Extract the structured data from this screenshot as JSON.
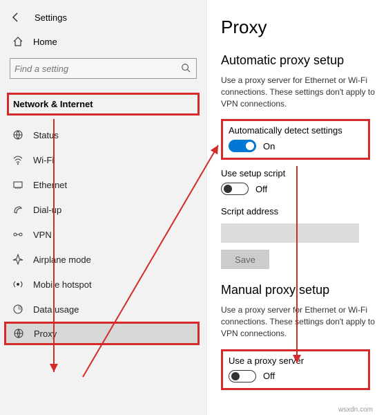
{
  "header": {
    "title": "Settings",
    "home_label": "Home",
    "search_placeholder": "Find a setting"
  },
  "category": "Network & Internet",
  "nav": {
    "items": [
      {
        "label": "Status"
      },
      {
        "label": "Wi-Fi"
      },
      {
        "label": "Ethernet"
      },
      {
        "label": "Dial-up"
      },
      {
        "label": "VPN"
      },
      {
        "label": "Airplane mode"
      },
      {
        "label": "Mobile hotspot"
      },
      {
        "label": "Data usage"
      },
      {
        "label": "Proxy"
      }
    ]
  },
  "main": {
    "title": "Proxy",
    "section1": {
      "title": "Automatic proxy setup",
      "desc": "Use a proxy server for Ethernet or Wi-Fi connections. These settings don't apply to VPN connections.",
      "auto_detect_label": "Automatically detect settings",
      "auto_detect_state": "On",
      "script_label": "Use setup script",
      "script_state": "Off",
      "script_addr_label": "Script address",
      "save_label": "Save"
    },
    "section2": {
      "title": "Manual proxy setup",
      "desc": "Use a proxy server for Ethernet or Wi-Fi connections. These settings don't apply to VPN connections.",
      "use_proxy_label": "Use a proxy server",
      "use_proxy_state": "Off"
    }
  },
  "watermark": "wsxdn.com",
  "annotation_color": "#d42a2a"
}
